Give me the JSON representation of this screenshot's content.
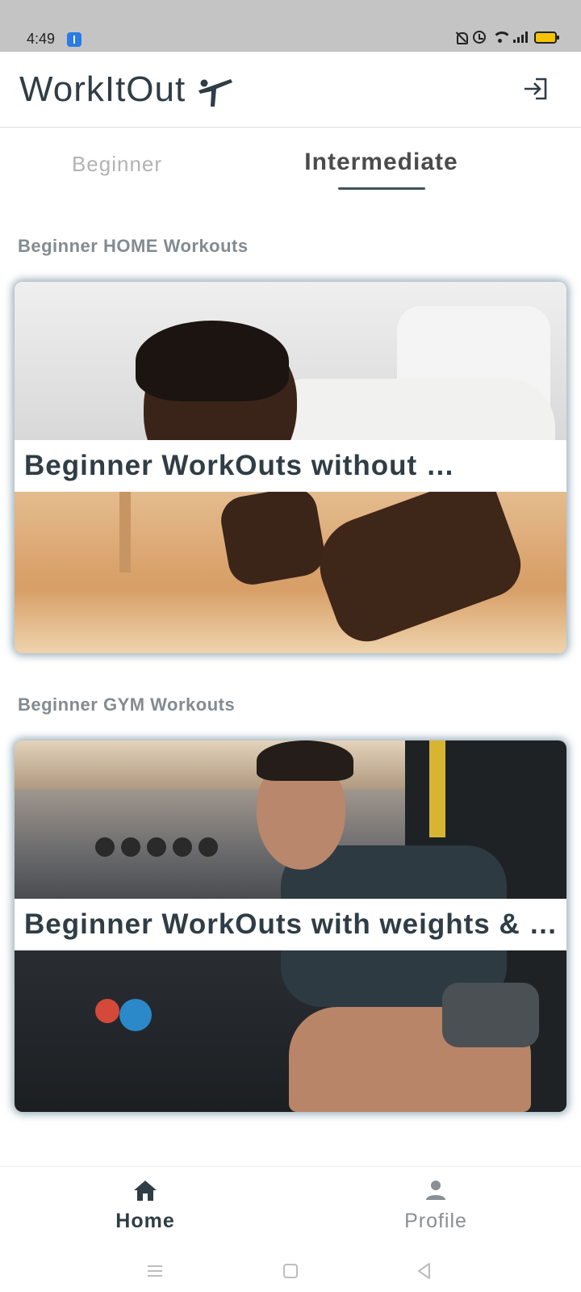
{
  "status_bar": {
    "time": "4:49"
  },
  "app_bar": {
    "title": "WorkItOut",
    "logo_icon": "martial-arts-kick-icon",
    "logout_icon": "login-arrow-icon"
  },
  "tabs": [
    {
      "label": "Beginner",
      "selected": false
    },
    {
      "label": "Intermediate",
      "selected": true
    }
  ],
  "sections": [
    {
      "heading": "Beginner HOME Workouts",
      "card_title": "Beginner WorkOuts without …"
    },
    {
      "heading": "Beginner GYM Workouts",
      "card_title": "Beginner WorkOuts with weights & …"
    }
  ],
  "bottom_nav": {
    "items": [
      {
        "label": "Home",
        "icon": "home-icon",
        "active": true
      },
      {
        "label": "Profile",
        "icon": "person-icon",
        "active": false
      }
    ]
  },
  "colors": {
    "primary_text": "#2f3d46",
    "tab_indicator": "#3c5360",
    "section_heading": "#838b91",
    "status_bar": "#c4c4c4",
    "battery": "#f5c400"
  }
}
